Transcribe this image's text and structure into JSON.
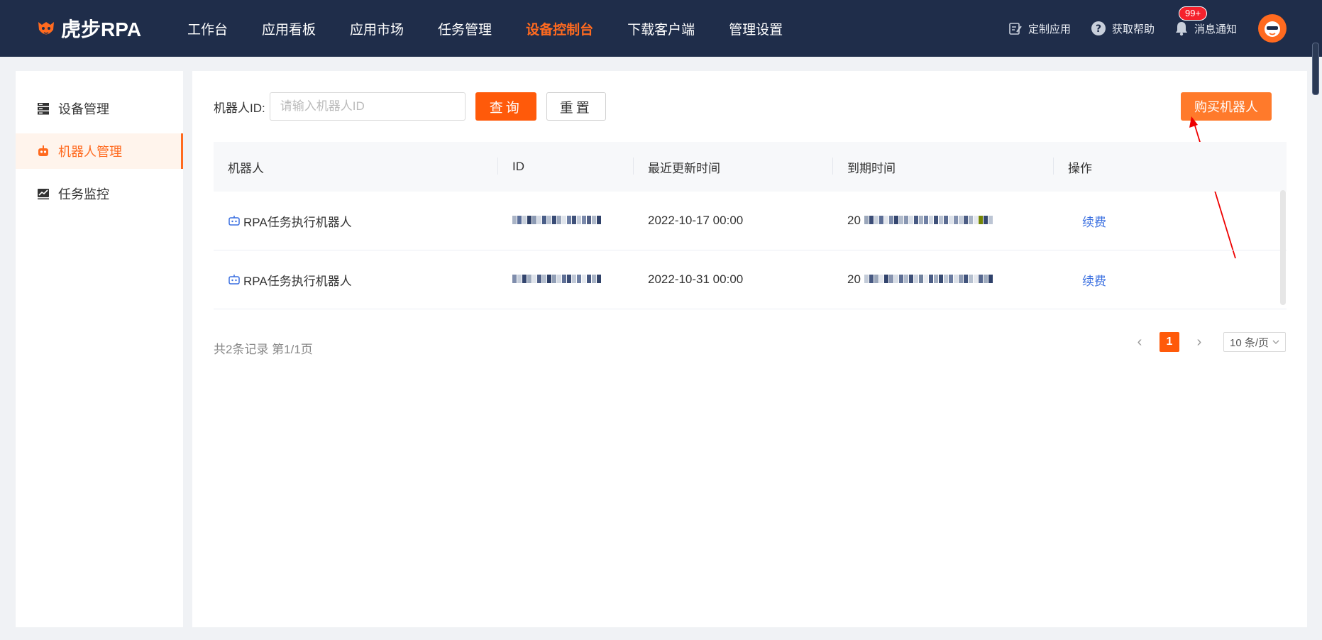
{
  "brand": {
    "name": "虎步RPA",
    "accent": "#ff5a0a",
    "nav_bg": "#1f2d4a"
  },
  "nav": {
    "items": [
      {
        "label": "工作台"
      },
      {
        "label": "应用看板"
      },
      {
        "label": "应用市场"
      },
      {
        "label": "任务管理"
      },
      {
        "label": "设备控制台",
        "active": true
      },
      {
        "label": "下载客户端"
      },
      {
        "label": "管理设置"
      }
    ]
  },
  "tools": {
    "custom_app": "定制应用",
    "help": "获取帮助",
    "notify": "消息通知",
    "notify_badge": "99+"
  },
  "sidebar": {
    "items": [
      {
        "label": "设备管理",
        "icon": "server-icon"
      },
      {
        "label": "机器人管理",
        "icon": "robot-icon",
        "active": true
      },
      {
        "label": "任务监控",
        "icon": "chart-monitor-icon"
      }
    ]
  },
  "filter": {
    "label": "机器人ID:",
    "placeholder": "请输入机器人ID",
    "value": "",
    "query_label": "查询",
    "reset_label": "重置"
  },
  "buy_button": "购买机器人",
  "table": {
    "columns": [
      "机器人",
      "ID",
      "最近更新时间",
      "到期时间",
      "操作"
    ],
    "rows": [
      {
        "robot": "RPA任务执行机器人",
        "id": "(redacted)",
        "updated": "2022-10-17 00:00",
        "expire_prefix": "20",
        "action": "续费"
      },
      {
        "robot": "RPA任务执行机器人",
        "id": "(redacted)",
        "updated": "2022-10-31 00:00",
        "expire_prefix": "20",
        "action": "续费"
      }
    ]
  },
  "footer": {
    "summary": "共2条记录 第1/1页",
    "current_page": "1",
    "page_size": "10 条/页"
  }
}
